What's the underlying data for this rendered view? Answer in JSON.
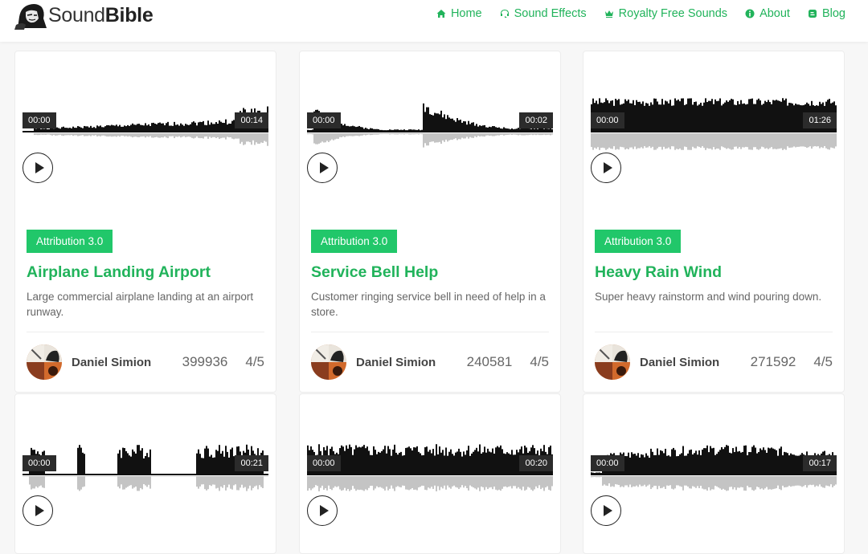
{
  "site": {
    "logo_plain": "Sound",
    "logo_bold": "Bible"
  },
  "nav": [
    {
      "label": "Home",
      "icon": "home-icon"
    },
    {
      "label": "Sound Effects",
      "icon": "headset-icon"
    },
    {
      "label": "Royalty Free Sounds",
      "icon": "crown-icon"
    },
    {
      "label": "About",
      "icon": "info-icon"
    },
    {
      "label": "Blog",
      "icon": "blog-icon"
    }
  ],
  "colors": {
    "accent": "#21b35b",
    "badge": "#21c76a",
    "wave": "#111111",
    "wave_reflection": "#c4c4c4"
  },
  "cards": [
    {
      "start": "00:00",
      "duration": "00:14",
      "badge": "Attribution 3.0",
      "title": "Airplane Landing Airport",
      "description": "Large commercial airplane landing at an airport runway.",
      "author": "Daniel Simion",
      "downloads": "399936",
      "rating": "4/5"
    },
    {
      "start": "00:00",
      "duration": "00:02",
      "badge": "Attribution 3.0",
      "title": "Service Bell Help",
      "description": "Customer ringing service bell in need of help in a store.",
      "author": "Daniel Simion",
      "downloads": "240581",
      "rating": "4/5"
    },
    {
      "start": "00:00",
      "duration": "01:26",
      "badge": "Attribution 3.0",
      "title": "Heavy Rain Wind",
      "description": "Super heavy rainstorm and wind pouring down.",
      "author": "Daniel Simion",
      "downloads": "271592",
      "rating": "4/5"
    },
    {
      "start": "00:00",
      "duration": "00:21"
    },
    {
      "start": "00:00",
      "duration": "00:20"
    },
    {
      "start": "00:00",
      "duration": "00:17"
    }
  ]
}
